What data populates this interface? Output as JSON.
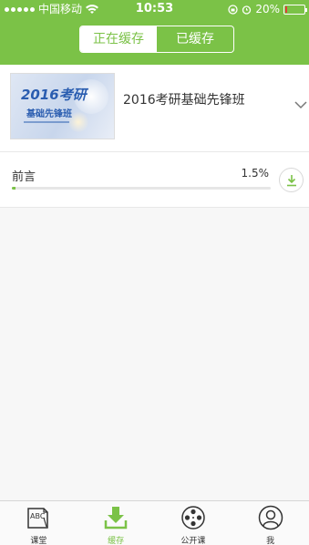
{
  "status_bar": {
    "carrier": "中国移动",
    "time": "10:53",
    "battery": "20%",
    "battery_level": 0.2,
    "signal_dots": 5
  },
  "segmented": {
    "options": [
      "正在缓存",
      "已缓存"
    ],
    "selected": 0
  },
  "course": {
    "title": "2016考研基础先锋班",
    "thumbnail_text_1": "2016考研",
    "thumbnail_text_2": "基础先锋班",
    "expand_icon": "chevron-down-icon"
  },
  "download_item": {
    "title": "前言",
    "percent_text": "1.5%",
    "progress": 0.015,
    "action_icon": "download-icon"
  },
  "tabbar": {
    "tabs": [
      {
        "label": "课堂",
        "icon": "abc-book-icon"
      },
      {
        "label": "缓存",
        "icon": "download-tray-icon"
      },
      {
        "label": "公开课",
        "icon": "film-reel-icon"
      },
      {
        "label": "我",
        "icon": "user-icon"
      }
    ],
    "active_index": 1
  },
  "colors": {
    "accent": "#7bc247",
    "battery_low": "#e0403a"
  }
}
